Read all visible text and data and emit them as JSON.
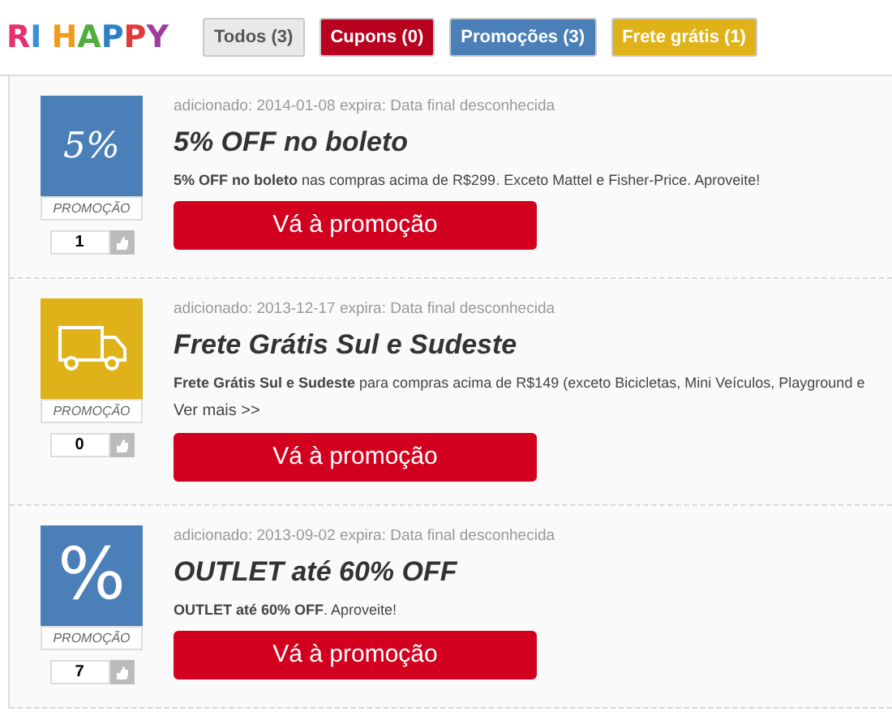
{
  "logo": {
    "words": [
      {
        "letters": [
          {
            "text": "R",
            "color": "#e5316f"
          },
          {
            "text": "I",
            "color": "#3b8fd6"
          }
        ]
      },
      {
        "letters": [
          {
            "text": "H",
            "color": "#f29a1d"
          },
          {
            "text": "A",
            "color": "#4fae3c"
          },
          {
            "text": "P",
            "color": "#2f7fc8"
          },
          {
            "text": "P",
            "color": "#e23a3a"
          },
          {
            "text": "Y",
            "color": "#9a3fa0"
          }
        ]
      }
    ]
  },
  "filters": [
    {
      "label": "Todos (3)",
      "color": "#e9e9e9"
    },
    {
      "label": "Cupons (0)",
      "color": "#b8001f"
    },
    {
      "label": "Promoções (3)",
      "color": "#4a7fb8"
    },
    {
      "label": "Frete grátis (1)",
      "color": "#e0b21a"
    }
  ],
  "offers": [
    {
      "tile": {
        "kind": "text",
        "text": "5%",
        "color": "#4a7fb8"
      },
      "tile_label": "PROMOÇÃO",
      "votes": "1",
      "meta": "adicionado: 2014-01-08 expira: Data final desconhecida",
      "title": "5% OFF no boleto",
      "description": "**5% OFF no boleto** nas compras acima de R$299. Exceto Mattel e Fisher-Price. Aproveite!",
      "button": "Vá à promoção"
    },
    {
      "tile": {
        "kind": "truck",
        "color": "#e0b21a"
      },
      "tile_label": "PROMOÇÃO",
      "votes": "0",
      "meta": "adicionado: 2013-12-17 expira: Data final desconhecida",
      "title": "Frete Grátis Sul e Sudeste",
      "description": "**Frete Grátis Sul e Sudeste** para compras acima de R$149 (exceto Bicicletas, Mini Veículos, Playground e",
      "more": "Ver mais >>",
      "button": "Vá à promoção"
    },
    {
      "tile": {
        "kind": "symbol",
        "text": "%",
        "color": "#4a7fb8"
      },
      "tile_label": "PROMOÇÃO",
      "votes": "7",
      "meta": "adicionado: 2013-09-02 expira: Data final desconhecida",
      "title": "OUTLET até 60% OFF",
      "description": "**OUTLET até 60% OFF**. Aproveite!",
      "button": "Vá à promoção"
    }
  ]
}
